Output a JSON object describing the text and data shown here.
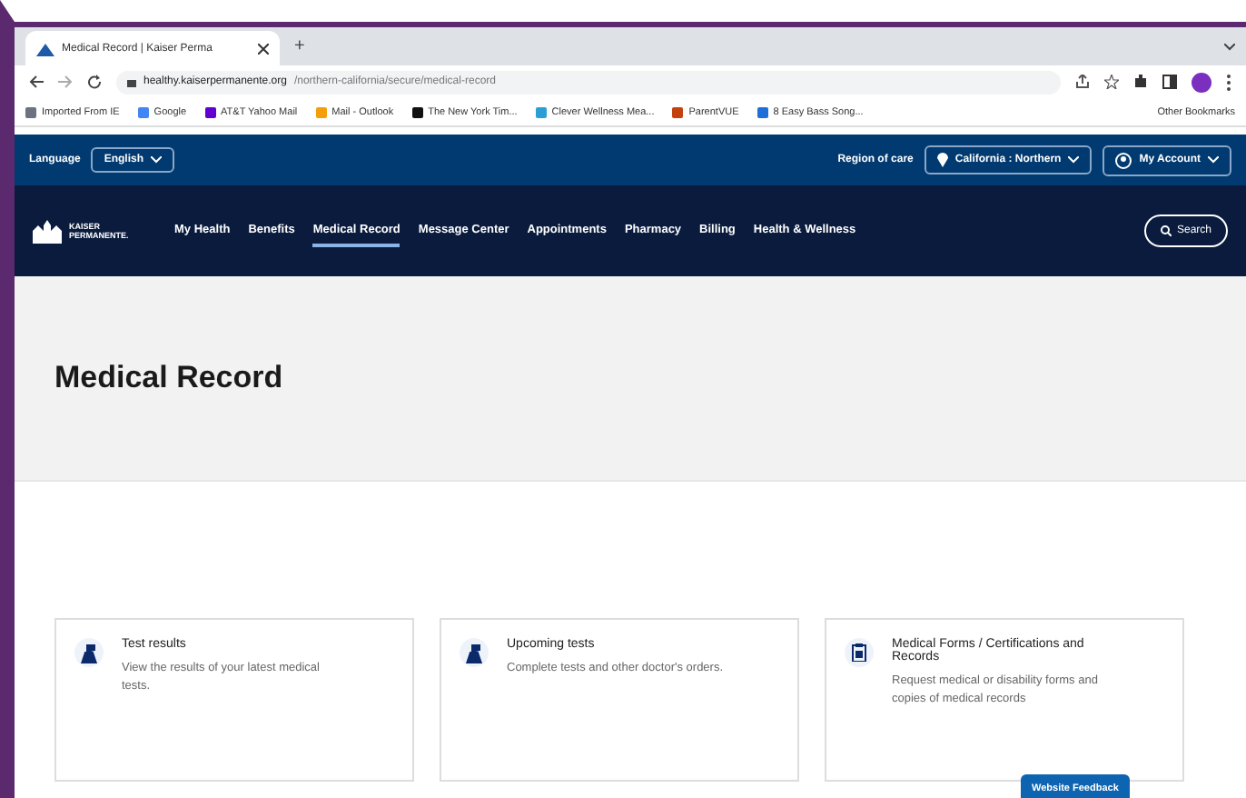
{
  "browser": {
    "tab_title": "Medical Record | Kaiser Perma",
    "new_tab": "+",
    "url_host": "healthy.kaiserpermanente.org",
    "url_path": "/northern-california/secure/medical-record",
    "bookmarks": [
      {
        "label": "Imported From IE",
        "color": "#6b7280"
      },
      {
        "label": "Google",
        "color": "#4285f4"
      },
      {
        "label": "AT&T Yahoo Mail",
        "color": "#6001d2"
      },
      {
        "label": "Mail - Outlook",
        "color": "#f59e0b"
      },
      {
        "label": "The New York Tim...",
        "color": "#111111"
      },
      {
        "label": "Clever Wellness Mea...",
        "color": "#2a9fd6"
      },
      {
        "label": "ParentVUE",
        "color": "#c2410c"
      },
      {
        "label": "8 Easy Bass Song...",
        "color": "#1e6fd9"
      }
    ],
    "other_bookmarks": "Other Bookmarks"
  },
  "utility_bar": {
    "language_label": "Language",
    "language": "English",
    "region_label": "Region of care",
    "region": "California : Northern",
    "account": "My Account"
  },
  "nav": {
    "logo": "KAISER PERMANENTE.",
    "items": [
      {
        "label": "My Health",
        "selected": false
      },
      {
        "label": "Benefits",
        "selected": false
      },
      {
        "label": "Medical Record",
        "selected": true
      },
      {
        "label": "Message Center",
        "selected": false
      },
      {
        "label": "Appointments",
        "selected": false
      },
      {
        "label": "Pharmacy",
        "selected": false
      },
      {
        "label": "Billing",
        "selected": false
      },
      {
        "label": "Health & Wellness",
        "selected": false
      }
    ],
    "search": "Search"
  },
  "page_title": "Medical Record",
  "cards": [
    {
      "kind": "tests",
      "title": "Test results",
      "description": "View the results of your latest medical tests."
    },
    {
      "kind": "tests",
      "title": "Upcoming tests",
      "description": "Complete tests and other doctor's orders."
    },
    {
      "kind": "forms",
      "title": "Medical Forms / Certifications and Records",
      "description": "Request medical or disability forms and copies of medical records"
    }
  ],
  "feedback_button": "Website Feedback"
}
